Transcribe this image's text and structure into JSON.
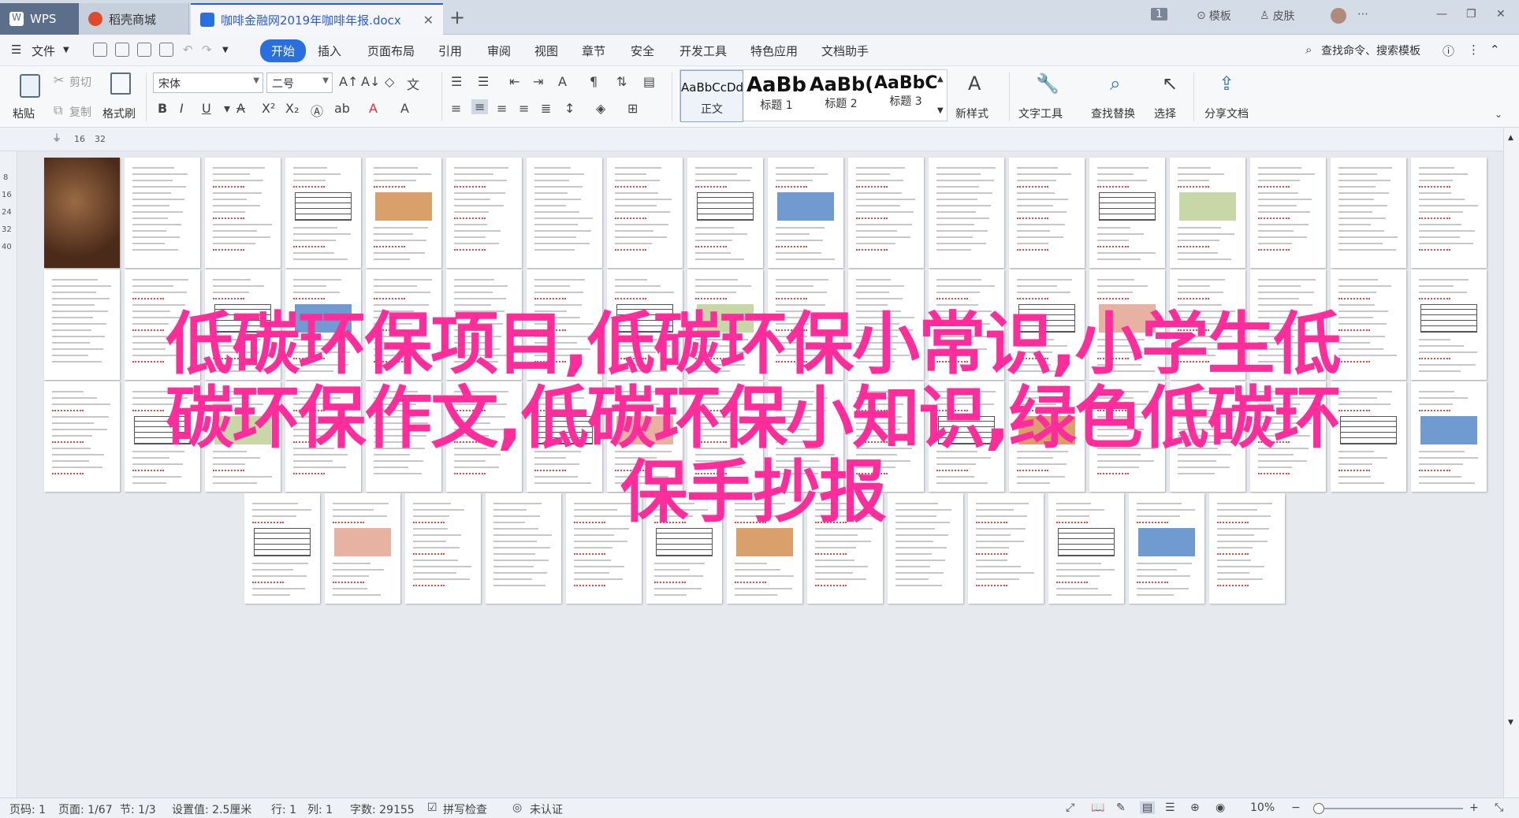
{
  "titlebar": {
    "tabs": [
      {
        "label": "WPS"
      },
      {
        "label": "稻壳商城"
      },
      {
        "label": "咖啡金融网2019年咖啡年报.docx"
      }
    ],
    "right": {
      "badge": "1",
      "template": "模板",
      "skin": "皮肤"
    }
  },
  "menubar": {
    "file": "文件",
    "items": [
      "开始",
      "插入",
      "页面布局",
      "引用",
      "审阅",
      "视图",
      "章节",
      "安全",
      "开发工具",
      "特色应用",
      "文档助手"
    ],
    "search": "查找命令、搜索模板"
  },
  "ribbon": {
    "paste": "粘贴",
    "cut": "剪切",
    "copy": "复制",
    "format_painter": "格式刷",
    "font_name": "宋体",
    "font_size": "二号",
    "styles": [
      {
        "preview": "AaBbCcDd",
        "name": "正文"
      },
      {
        "preview": "AaBb",
        "name": "标题 1"
      },
      {
        "preview": "AaBb(",
        "name": "标题 2"
      },
      {
        "preview": "AaBbC",
        "name": "标题 3"
      }
    ],
    "new_style": "新样式",
    "text_tools": "文字工具",
    "find_replace": "查找替换",
    "select": "选择",
    "share_doc": "分享文档"
  },
  "ruler": {
    "marks": [
      "16",
      "32"
    ],
    "vmarks": [
      "8",
      "16",
      "24",
      "32",
      "40"
    ]
  },
  "overlay": {
    "line1": "低碳环保项目,低碳环保小常识,小学生低",
    "line2": "碳环保作文,低碳环保小知识,绿色低碳环",
    "line3": "保手抄报"
  },
  "statusbar": {
    "page_no": "页码: 1",
    "pages": "页面: 1/67",
    "section": "节: 1/3",
    "setting": "设置值: 2.5厘米",
    "row": "行: 1",
    "col": "列: 1",
    "words": "字数: 29155",
    "spell": "拼写检查",
    "cert": "未认证",
    "zoom": "10%"
  },
  "colors": {
    "accent": "#2a6fde",
    "overlay_text": "#ff2d9b",
    "titlebar": "#d4dce7"
  }
}
